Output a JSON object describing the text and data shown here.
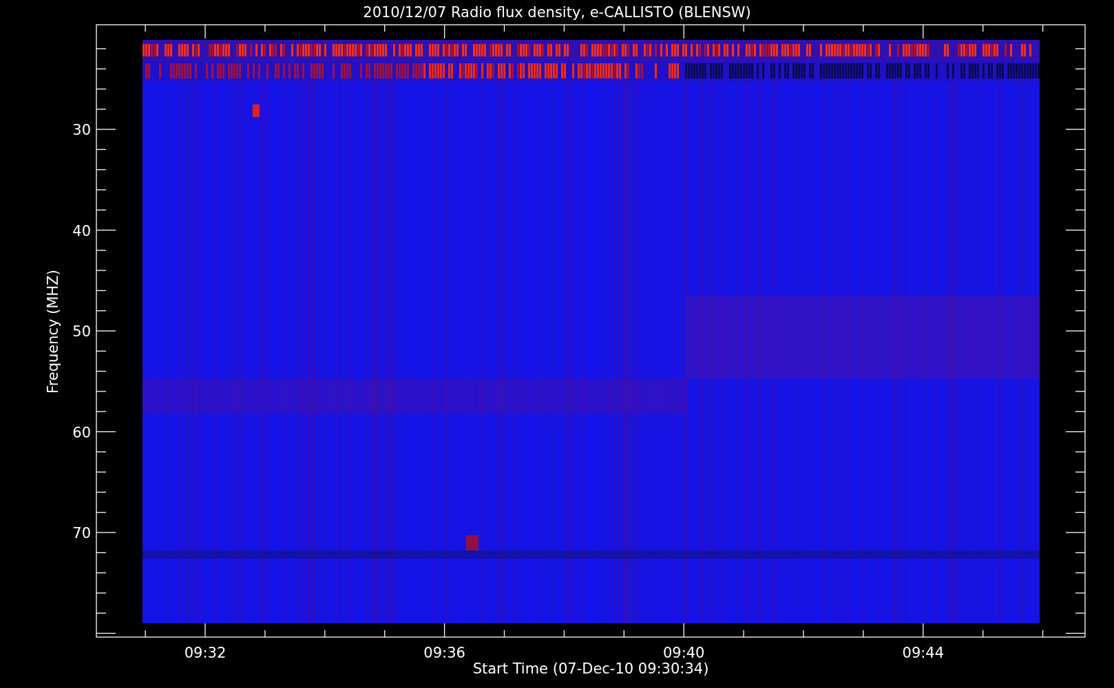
{
  "title": "2010/12/07  Radio flux density, e-CALLISTO (BLENSW)",
  "y_axis": {
    "label": "Frequency (MHZ)",
    "ticks": [
      "30",
      "40",
      "50",
      "60",
      "70"
    ]
  },
  "x_axis": {
    "label": "Start Time (07-Dec-10 09:30:34)",
    "ticks": [
      "09:32",
      "09:36",
      "09:40",
      "09:44"
    ]
  }
}
